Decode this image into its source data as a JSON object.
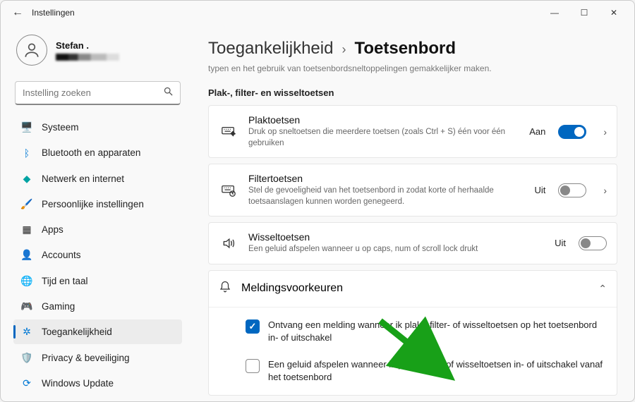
{
  "window": {
    "title": "Instellingen"
  },
  "user": {
    "name": "Stefan ."
  },
  "search": {
    "placeholder": "Instelling zoeken"
  },
  "sidebar": {
    "items": [
      {
        "label": "Systeem",
        "icon": "🖥️",
        "iconClass": "ic-blue"
      },
      {
        "label": "Bluetooth en apparaten",
        "icon": "ᛒ",
        "iconClass": "ic-blue"
      },
      {
        "label": "Netwerk en internet",
        "icon": "◆",
        "iconClass": "ic-teal"
      },
      {
        "label": "Persoonlijke instellingen",
        "icon": "🖌️",
        "iconClass": "ic-orange"
      },
      {
        "label": "Apps",
        "icon": "▦",
        "iconClass": ""
      },
      {
        "label": "Accounts",
        "icon": "👤",
        "iconClass": "ic-teal"
      },
      {
        "label": "Tijd en taal",
        "icon": "🌐",
        "iconClass": "ic-orange"
      },
      {
        "label": "Gaming",
        "icon": "🎮",
        "iconClass": ""
      },
      {
        "label": "Toegankelijkheid",
        "icon": "✲",
        "iconClass": "ic-blue",
        "active": true
      },
      {
        "label": "Privacy & beveiliging",
        "icon": "🛡️",
        "iconClass": ""
      },
      {
        "label": "Windows Update",
        "icon": "⟳",
        "iconClass": "ic-blue"
      }
    ]
  },
  "breadcrumb": {
    "parent": "Toegankelijkheid",
    "current": "Toetsenbord"
  },
  "clipped_desc": "typen en het gebruik van toetsenbordsneltoppelingen gemakkelijker maken.",
  "section": {
    "heading": "Plak-, filter- en wisseltoetsen"
  },
  "cards": {
    "sticky": {
      "title": "Plaktoetsen",
      "sub": "Druk op sneltoetsen die meerdere toetsen (zoals Ctrl + S) één voor één gebruiken",
      "state": "Aan"
    },
    "filter": {
      "title": "Filtertoetsen",
      "sub": "Stel de gevoeligheid van het toetsenbord in zodat korte of herhaalde toetsaanslagen kunnen worden genegeerd.",
      "state": "Uit"
    },
    "toggle": {
      "title": "Wisseltoetsen",
      "sub": "Een geluid afspelen wanneer u op caps, num of scroll lock drukt",
      "state": "Uit"
    }
  },
  "expander": {
    "title": "Meldingsvoorkeuren",
    "options": [
      {
        "label": "Ontvang een melding wanneer ik plak-, filter- of wisseltoetsen op het toetsenbord in- of uitschakel",
        "checked": true
      },
      {
        "label": "Een geluid afspelen wanneer ik plak-, filter- of wisseltoetsen in- of uitschakel vanaf het toetsenbord",
        "checked": false
      }
    ]
  }
}
